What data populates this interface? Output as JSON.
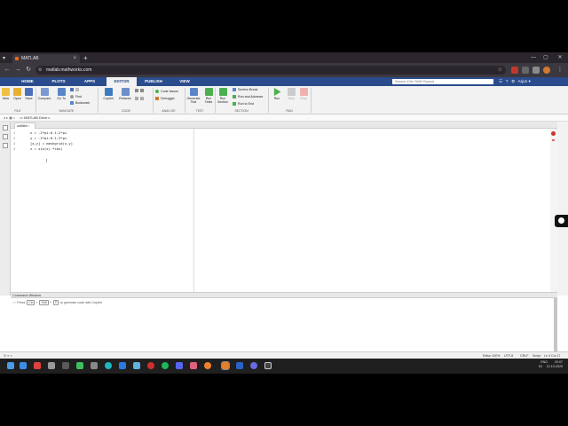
{
  "browser": {
    "tab_title": "MATLAB",
    "url": "matlab.mathworks.com",
    "new_tab": "+",
    "close": "×",
    "tab_menu": "▾"
  },
  "matlab": {
    "tabs": [
      "HOME",
      "PLOTS",
      "APPS",
      "EDITOR",
      "PUBLISH",
      "VIEW"
    ],
    "active_tab": "EDITOR",
    "search_placeholder": "Search (Ctrl+Shift+Space)",
    "user": "Arjun"
  },
  "ribbon": {
    "file": {
      "new": "New",
      "open": "Open",
      "save": "Save",
      "label": "FILE"
    },
    "navigate": {
      "compare": "Compare",
      "goto": "Go To",
      "find": "Find",
      "bookmark": "Bookmark",
      "label": "NAVIGATE"
    },
    "code": {
      "copilot": "Copilot",
      "refactor": "Refactor",
      "label": "CODE"
    },
    "analyze": {
      "code_issues": "Code Issues",
      "debugger": "Debugger",
      "label": "ANALYZE"
    },
    "test": {
      "generate": "Generate Test",
      "run_tests": "Run Tests",
      "label": "TEST"
    },
    "section": {
      "run_section": "Run Section",
      "section_break": "Section Break",
      "run_advance": "Run and Advance",
      "run_end": "Run to End",
      "label": "SECTION"
    },
    "run": {
      "run": "Run",
      "step": "Step",
      "stop": "Stop",
      "label": "RUN"
    }
  },
  "path": {
    "label": "MATLAB Drive"
  },
  "editor": {
    "tab": "untitled",
    "lines": [
      {
        "num": "1",
        "text": "x = -2*pi:0.1:2*pi"
      },
      {
        "num": "2",
        "text": "y = -2*pi:0.1:2*pi"
      },
      {
        "num": "3",
        "text": "[x,y] = meshgrid(x,y)"
      },
      {
        "num": "4",
        "text": "z = sin(x).*cos("
      }
    ]
  },
  "command_window": {
    "title": "Command Window",
    "hint_prefix": "Press",
    "key1": "Ctrl",
    "key2": "Shift",
    "key3": "P",
    "hint_suffix": "to generate code with Copilot",
    "prompt": ">>"
  },
  "status": {
    "editor": "Editor 100%",
    "encoding": "UTF-8",
    "eol": "CRLF",
    "type": "Script",
    "position": "Ln 4  Col 17"
  },
  "taskbar": {
    "lang": "ENG",
    "region": "IN",
    "time": "20:07",
    "date": "12-10-2025"
  },
  "colors": {
    "matlab_blue": "#2b4c8c",
    "run_green": "#4caf50",
    "stop_red": "#e05050"
  }
}
